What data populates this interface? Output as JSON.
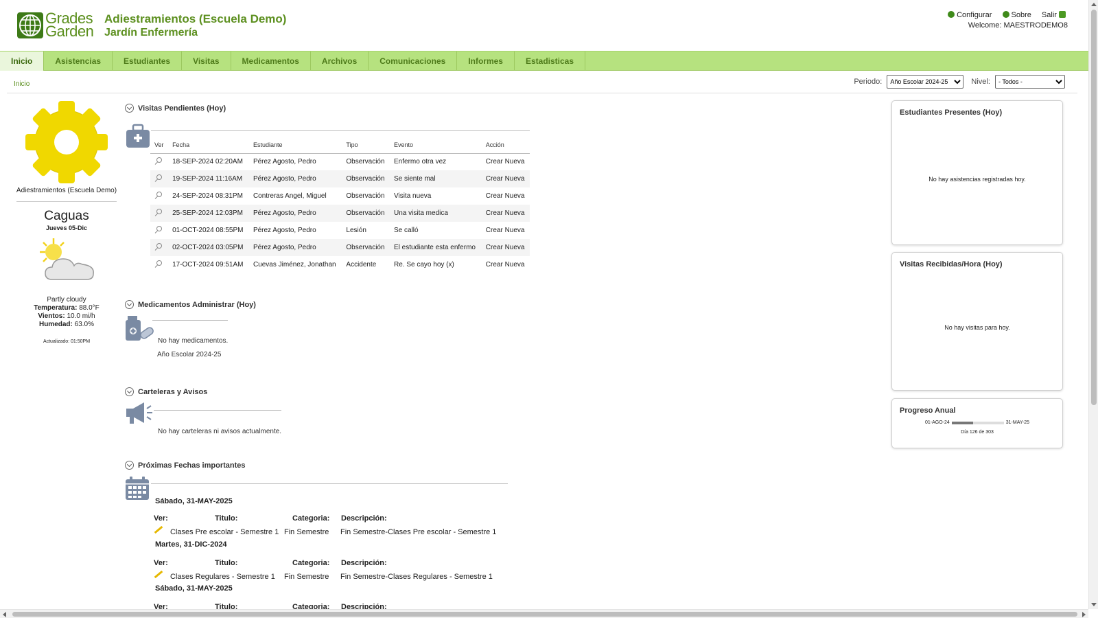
{
  "header": {
    "brand_line1": "Grades",
    "brand_line2": "Garden",
    "school_title": "Adiestramientos (Escuela Demo)",
    "school_subtitle": "Jardín Enfermería",
    "links": {
      "configure": "Configurar",
      "about": "Sobre",
      "logout": "Salir"
    },
    "welcome": "Welcome: MAESTRODEMO8"
  },
  "nav": {
    "tabs": [
      "Inicio",
      "Asistencias",
      "Estudiantes",
      "Visitas",
      "Medicamentos",
      "Archivos",
      "Comunicaciones",
      "Informes",
      "Estadisticas"
    ],
    "active": "Inicio"
  },
  "breadcrumb": "Inicio",
  "filters": {
    "period_label": "Periodo:",
    "period_value": "Año Escolar 2024-25",
    "level_label": "Nivel:",
    "level_value": "- Todos -"
  },
  "left": {
    "school_name": "Adiestramientos (Escuela Demo)",
    "city": "Caguas",
    "date": "Jueves 05-Dic",
    "condition": "Partly cloudy",
    "temp_label": "Temperatura:",
    "temp_value": "88.0°F",
    "wind_label": "Vientos:",
    "wind_value": "10.0 mi/h",
    "humidity_label": "Humedad:",
    "humidity_value": "63.0%",
    "updated": "Actualizado: 01:50PM",
    "gear_color": "#f0d800"
  },
  "visits": {
    "title": "Visitas Pendientes (Hoy)",
    "headers": [
      "Ver",
      "Fecha",
      "Estudiante",
      "Tipo",
      "Evento",
      "Acción"
    ],
    "rows": [
      [
        "18-SEP-2024 02:20AM",
        "Pérez Agosto, Pedro",
        "Observación",
        "Enfermo otra vez",
        "Crear Nueva"
      ],
      [
        "19-SEP-2024 11:16AM",
        "Pérez Agosto, Pedro",
        "Observación",
        "Se siente mal",
        "Crear Nueva"
      ],
      [
        "24-SEP-2024 08:31PM",
        "Contreras Angel, Miguel",
        "Observación",
        "Visita nueva",
        "Crear Nueva"
      ],
      [
        "25-SEP-2024 12:03PM",
        "Pérez Agosto, Pedro",
        "Observación",
        "Una visita medica",
        "Crear Nueva"
      ],
      [
        "01-OCT-2024 08:55PM",
        "Pérez Agosto, Pedro",
        "Lesión",
        "Se calló",
        "Crear Nueva"
      ],
      [
        "02-OCT-2024 03:05PM",
        "Pérez Agosto, Pedro",
        "Observación",
        "El estudiante esta enfermo",
        "Crear Nueva"
      ],
      [
        "17-OCT-2024 09:51AM",
        "Cuevas Jiménez, Jonathan",
        "Accidente",
        "Re. Se cayo hoy (x)",
        "Crear Nueva"
      ]
    ]
  },
  "meds": {
    "title": "Medicamentos Administrar (Hoy)",
    "empty": "No hay medicamentos.",
    "period": "Año Escolar 2024-25"
  },
  "boards": {
    "title": "Carteleras y Avisos",
    "empty": "No hay carteleras ni avisos actualmente."
  },
  "dates": {
    "title": "Próximas Fechas importantes",
    "headers": {
      "view": "Ver:",
      "title": "Titulo:",
      "category": "Categoria:",
      "description": "Descripción:"
    },
    "groups": [
      {
        "day": "Sábado, 31-MAY-2025",
        "title": "Clases Pre escolar - Semestre 1",
        "category": "Fin Semestre",
        "description": "Fin Semestre-Clases Pre escolar - Semestre 1"
      },
      {
        "day": "Martes, 31-DIC-2024",
        "title": "Clases Regulares - Semestre 1",
        "category": "Fin Semestre",
        "description": "Fin Semestre-Clases Regulares - Semestre 1"
      },
      {
        "day": "Sábado, 31-MAY-2025"
      }
    ]
  },
  "panels": {
    "present_title": "Estudiantes Presentes (Hoy)",
    "present_empty": "No hay asistencias registradas hoy.",
    "visits_title": "Visitas Recibidas/Hora (Hoy)",
    "visits_empty": "No hay visitas para hoy.",
    "progress_title": "Progreso Anual",
    "progress_start": "01-AGO-24",
    "progress_end": "31-MAY-25",
    "progress_day": "Día 126 de 303",
    "progress_fraction": 0.416
  },
  "colors": {
    "brand_green": "#5d9020",
    "nav_bg": "#b6e27f"
  }
}
